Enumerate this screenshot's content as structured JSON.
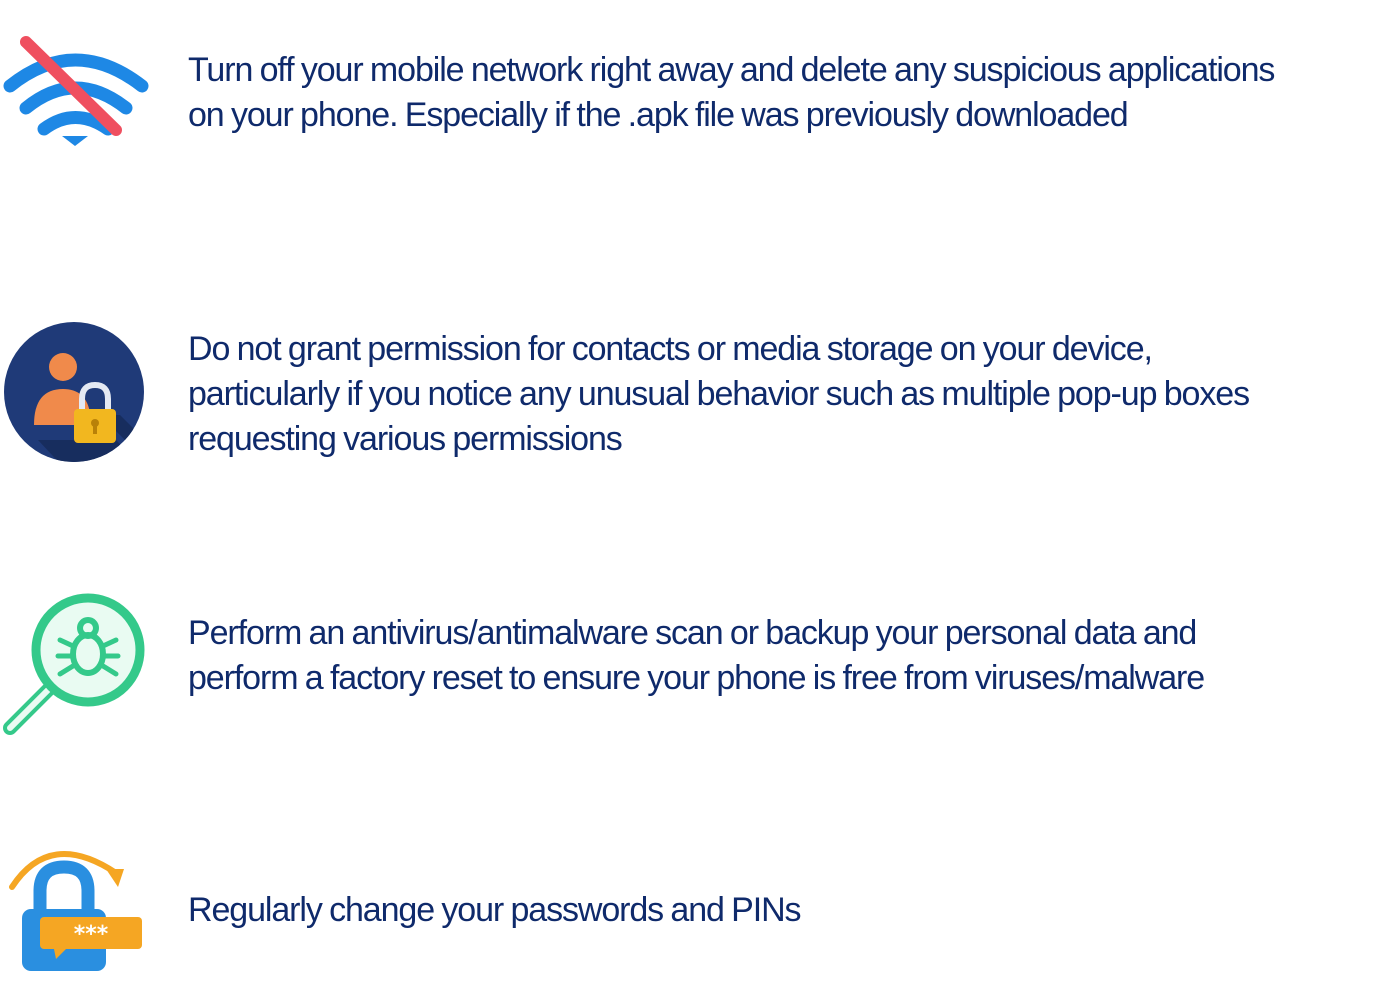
{
  "tips": [
    {
      "icon": "wifi-off-icon",
      "lines": [
        "Turn off your mobile network right away and delete any suspicious applications",
        "on your phone. Especially if the .apk file was previously downloaded"
      ]
    },
    {
      "icon": "user-lock-icon",
      "lines": [
        "Do not grant permission for contacts or media storage on your device,",
        "particularly if you notice any unusual behavior such as multiple pop-up boxes",
        "requesting various permissions"
      ]
    },
    {
      "icon": "bug-scan-icon",
      "lines": [
        "Perform an antivirus/antimalware scan or backup your personal data and",
        "perform a factory reset to ensure your phone is free from viruses/malware"
      ]
    },
    {
      "icon": "password-lock-icon",
      "lines": [
        "Regularly change your passwords and PINs"
      ],
      "icon_badge": "***"
    }
  ],
  "colors": {
    "text": "#0f2a6b",
    "wifi_blue": "#1e88e5",
    "slash_red": "#ef4f5f",
    "circle_navy": "#1f3a78",
    "person_orange": "#f08a4b",
    "lock_gold": "#f2b71f",
    "scan_green": "#34c98a",
    "lock_blue": "#2a8fe0",
    "badge_orange": "#f5a623"
  }
}
